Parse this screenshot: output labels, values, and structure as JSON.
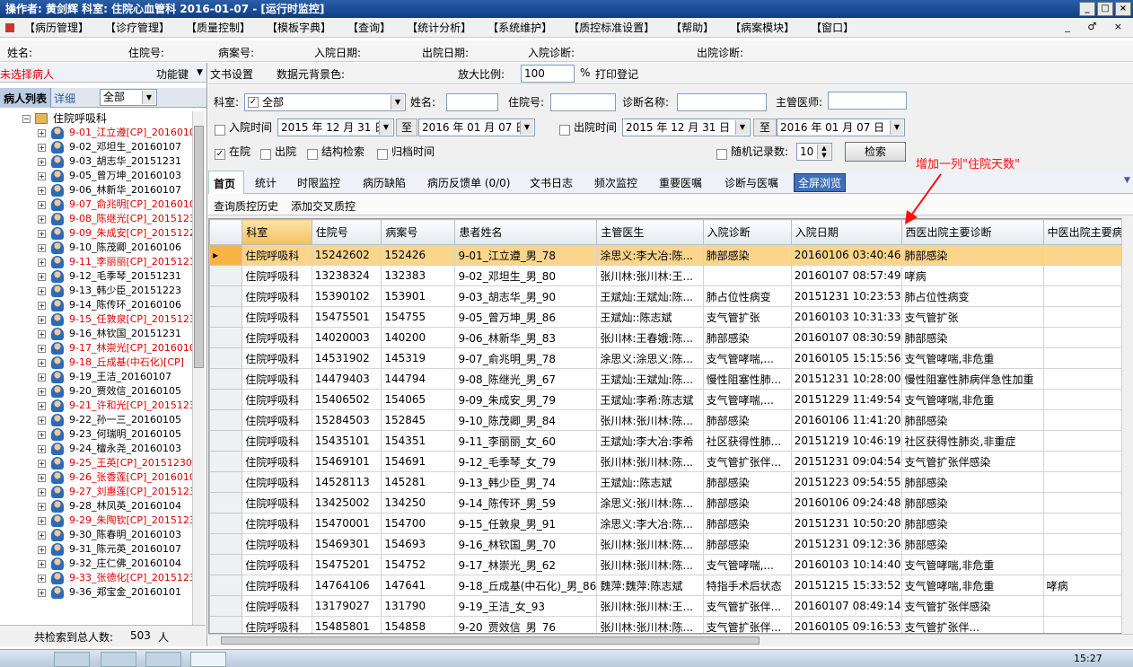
{
  "window": {
    "title": "操作者: 黄剑辉   科室: 住院心血管科   2016-01-07 - [运行时监控]",
    "buttons": [
      "_",
      "□",
      "×"
    ]
  },
  "menu": [
    "【病历管理】",
    "【诊疗管理】",
    "【质量控制】",
    "【模板字典】",
    "【查询】",
    "【统计分析】",
    "【系统维护】",
    "【质控标准设置】",
    "【帮助】",
    "【病案模块】",
    "【窗口】"
  ],
  "menu_win_controls": "_ ♂ ×",
  "infobar": {
    "name": "姓名:",
    "inpatient_no": "住院号:",
    "case_no": "病案号:",
    "admit_date": "入院日期:",
    "discharge_date": "出院日期:",
    "admit_diag": "入院诊断:",
    "discharge_diag": "出院诊断:"
  },
  "left": {
    "no_patient": "未选择病人",
    "func_key": "功能键",
    "tab_list": "病人列表",
    "tab_detail": "详细",
    "filter_value": "全部",
    "tree_root": "住院呼吸科",
    "total_label": "共检索到总人数:",
    "total_value": "503",
    "total_unit": "人",
    "patients": [
      {
        "t": "9-01_江立遵[CP]_2016010",
        "red": true
      },
      {
        "t": "9-02_邓坦生_20160107",
        "red": false
      },
      {
        "t": "9-03_胡志华_20151231",
        "red": false
      },
      {
        "t": "9-05_曾万坤_20160103",
        "red": false
      },
      {
        "t": "9-06_林新华_20160107",
        "red": false
      },
      {
        "t": "9-07_俞兆明[CP]_2016010",
        "red": true
      },
      {
        "t": "9-08_陈继光[CP]_2015123",
        "red": true
      },
      {
        "t": "9-09_朱成安[CP]_2015122",
        "red": true
      },
      {
        "t": "9-10_陈茂卿_20160106",
        "red": false
      },
      {
        "t": "9-11_李丽丽[CP]_2015121",
        "red": true
      },
      {
        "t": "9-12_毛季琴_20151231",
        "red": false
      },
      {
        "t": "9-13_韩少臣_20151223",
        "red": false
      },
      {
        "t": "9-14_陈传环_20160106",
        "red": false
      },
      {
        "t": "9-15_任敦泉[CP]_2015123",
        "red": true
      },
      {
        "t": "9-16_林钦国_20151231",
        "red": false
      },
      {
        "t": "9-17_林崇光[CP]_2016010",
        "red": true
      },
      {
        "t": "9-18_丘成基(中石化)[CP]",
        "red": true
      },
      {
        "t": "9-19_王洁_20160107",
        "red": false
      },
      {
        "t": "9-20_贾效信_20160105",
        "red": false
      },
      {
        "t": "9-21_许和光[CP]_2015123",
        "red": true
      },
      {
        "t": "9-22_孙一三_20160105",
        "red": false
      },
      {
        "t": "9-23_何瑞明_20160105",
        "red": false
      },
      {
        "t": "9-24_檀永尧_20160103",
        "red": false
      },
      {
        "t": "9-25_王英[CP]_20151230",
        "red": true
      },
      {
        "t": "9-26_张香莲[CP]_2016010",
        "red": true
      },
      {
        "t": "9-27_刘惠莲[CP]_2015123",
        "red": true
      },
      {
        "t": "9-28_林凤英_20160104",
        "red": false
      },
      {
        "t": "9-29_朱陶钦[CP]_2015123",
        "red": true
      },
      {
        "t": "9-30_陈春明_20160103",
        "red": false
      },
      {
        "t": "9-31_陈元英_20160107",
        "red": false
      },
      {
        "t": "9-32_庄仁佛_20160104",
        "red": false
      },
      {
        "t": "9-33_张德化[CP]_2015123",
        "red": true
      },
      {
        "t": "9-36_郑宝金_20160101",
        "red": false
      }
    ]
  },
  "right": {
    "toolbar": {
      "doc_settings": "文书设置",
      "bg_color": "数据元背景色:",
      "zoom_label": "放大比例:",
      "zoom_value": "100",
      "zoom_unit": "%",
      "print_reg": "打印登记"
    },
    "filter": {
      "dept_label": "科室:",
      "dept_value": "全部",
      "name_label": "姓名:",
      "inpatient_label": "住院号:",
      "diag_label": "诊断名称:",
      "doctor_label": "主管医师:",
      "admit_time": "入院时间",
      "admit_from": "2015 年 12 月 31 日",
      "to": "至",
      "admit_to": "2016 年 01 月 07 日",
      "discharge_time": "出院时间",
      "dis_from": "2015 年 12 月 31 日",
      "dis_to": "2016 年 01 月 07 日",
      "in_hospital": "在院",
      "discharged": "出院",
      "struct_search": "结构检索",
      "archive_time": "归档时间",
      "random_label": "随机记录数:",
      "random_value": "10",
      "search_btn": "检索"
    },
    "tabs": [
      "首页",
      "统计",
      "时限监控",
      "病历缺陷",
      "病历反馈单 (0/0)",
      "文书日志",
      "频次监控",
      "重要医嘱",
      "诊断与医嘱",
      "全屏浏览"
    ],
    "subbar": [
      "查询质控历史",
      "添加交叉质控"
    ],
    "annotation": "增加一列\"住院天数\"",
    "columns": [
      "科室",
      "住院号",
      "病案号",
      "患者姓名",
      "主管医生",
      "入院诊断",
      "入院日期",
      "西医出院主要诊断",
      "中医出院主要病"
    ],
    "rows": [
      [
        "住院呼吸科",
        "15242602",
        "152426",
        "9-01_江立遵_男_78",
        "涂思义:李大冶:陈...",
        "肺部感染",
        "20160106 03:40:46",
        "肺部感染",
        ""
      ],
      [
        "住院呼吸科",
        "13238324",
        "132383",
        "9-02_邓坦生_男_80",
        "张川林:张川林:王...",
        "",
        "20160107 08:57:49",
        "哮病",
        ""
      ],
      [
        "住院呼吸科",
        "15390102",
        "153901",
        "9-03_胡志华_男_90",
        "王斌灿:王斌灿:陈...",
        "肺占位性病变",
        "20151231 10:23:53",
        "肺占位性病变",
        ""
      ],
      [
        "住院呼吸科",
        "15475501",
        "154755",
        "9-05_曾万坤_男_86",
        "王斌灿::陈志斌",
        "支气管扩张",
        "20160103 10:31:33",
        "支气管扩张",
        ""
      ],
      [
        "住院呼吸科",
        "14020003",
        "140200",
        "9-06_林新华_男_83",
        "张川林:王春娥:陈...",
        "肺部感染",
        "20160107 08:30:59",
        "肺部感染",
        ""
      ],
      [
        "住院呼吸科",
        "14531902",
        "145319",
        "9-07_俞兆明_男_78",
        "涂思义:涂思义:陈...",
        "支气管哮喘,...",
        "20160105 15:15:56",
        "支气管哮喘,非危重",
        ""
      ],
      [
        "住院呼吸科",
        "14479403",
        "144794",
        "9-08_陈继光_男_67",
        "王斌灿:王斌灿:陈...",
        "慢性阻塞性肺...",
        "20151231 10:28:00",
        "慢性阻塞性肺病伴急性加重",
        ""
      ],
      [
        "住院呼吸科",
        "15406502",
        "154065",
        "9-09_朱成安_男_79",
        "王斌灿:李希:陈志斌",
        "支气管哮喘,...",
        "20151229 11:49:54",
        "支气管哮喘,非危重",
        ""
      ],
      [
        "住院呼吸科",
        "15284503",
        "152845",
        "9-10_陈茂卿_男_84",
        "张川林:张川林:陈...",
        "肺部感染",
        "20160106 11:41:20",
        "肺部感染",
        ""
      ],
      [
        "住院呼吸科",
        "15435101",
        "154351",
        "9-11_李丽丽_女_60",
        "王斌灿:李大冶:李希",
        "社区获得性肺...",
        "20151219 10:46:19",
        "社区获得性肺炎,非重症",
        ""
      ],
      [
        "住院呼吸科",
        "15469101",
        "154691",
        "9-12_毛季琴_女_79",
        "张川林:张川林:陈...",
        "支气管扩张伴...",
        "20151231 09:04:54",
        "支气管扩张伴感染",
        ""
      ],
      [
        "住院呼吸科",
        "14528113",
        "145281",
        "9-13_韩少臣_男_74",
        "王斌灿::陈志斌",
        "肺部感染",
        "20151223 09:54:55",
        "肺部感染",
        ""
      ],
      [
        "住院呼吸科",
        "13425002",
        "134250",
        "9-14_陈传环_男_59",
        "涂思义:张川林:陈...",
        "肺部感染",
        "20160106 09:24:48",
        "肺部感染",
        ""
      ],
      [
        "住院呼吸科",
        "15470001",
        "154700",
        "9-15_任敦泉_男_91",
        "涂思义:李大冶:陈...",
        "肺部感染",
        "20151231 10:50:20",
        "肺部感染",
        ""
      ],
      [
        "住院呼吸科",
        "15469301",
        "154693",
        "9-16_林钦国_男_70",
        "张川林:张川林:陈...",
        "肺部感染",
        "20151231 09:12:36",
        "肺部感染",
        ""
      ],
      [
        "住院呼吸科",
        "15475201",
        "154752",
        "9-17_林崇光_男_62",
        "张川林:张川林:陈...",
        "支气管哮喘,...",
        "20160103 10:14:40",
        "支气管哮喘,非危重",
        ""
      ],
      [
        "住院呼吸科",
        "14764106",
        "147641",
        "9-18_丘成基(中石化)_男_86",
        "魏萍:魏萍:陈志斌",
        "特指手术后状态",
        "20151215 15:33:52",
        "支气管哮喘,非危重",
        "哮病"
      ],
      [
        "住院呼吸科",
        "13179027",
        "131790",
        "9-19_王洁_女_93",
        "张川林:张川林:王...",
        "支气管扩张伴...",
        "20160107 08:49:14",
        "支气管扩张伴感染",
        ""
      ],
      [
        "住院呼吸科",
        "15485801",
        "154858",
        "9-20_贾效信_男_76",
        "张川林:张川林:陈...",
        "支气管扩张伴...",
        "20160105 09:16:53",
        "支气管扩张伴...",
        ""
      ]
    ]
  },
  "taskbar_time": "15:27",
  "colors": {
    "selected_row": "#fbd58c",
    "red_text": "#e00000",
    "annotation": "#ff1010",
    "title_bg": "#0e3d86"
  }
}
